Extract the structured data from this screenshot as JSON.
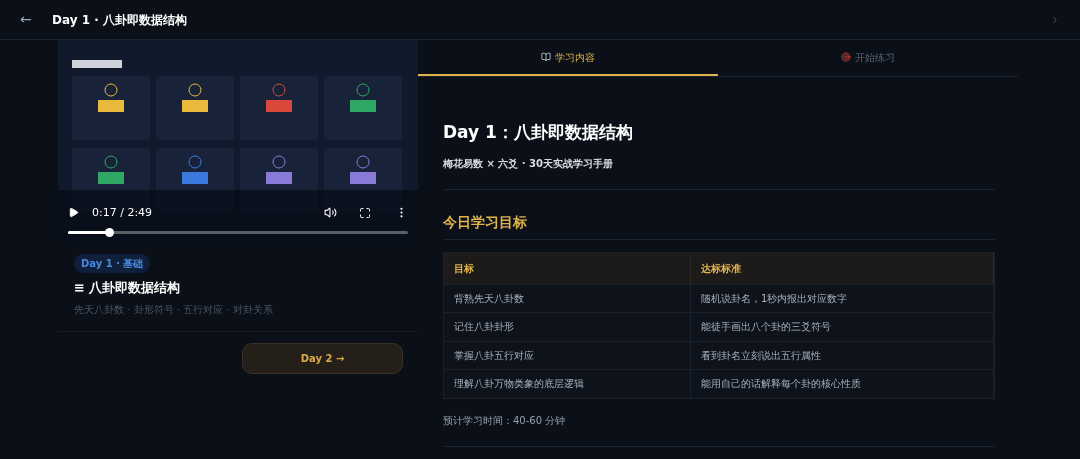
{
  "header": {
    "back": "←",
    "title": "Day 1 · 八卦即数据结构"
  },
  "video": {
    "kind": "picture",
    "time": "0:17 / 2:49",
    "level": 0.12
  },
  "lesson": {
    "badge": "Day 1 · 基础",
    "title": "≡ 八卦即数据结构",
    "topics": "先天八卦数 · 卦形符号 · 五行对应 · 对卦关系",
    "next": "Day 2 →"
  },
  "tabs": [
    {
      "label": "学习内容",
      "selected": true
    },
    {
      "label": "开始练习",
      "selected": false
    }
  ],
  "content": {
    "title": "Day 1：八卦即数据结构",
    "subtitle": "梅花易数 × 六爻 · 30天实战学习手册",
    "section": "今日学习目标",
    "table": {
      "columns": [
        "目标",
        "达标标准"
      ],
      "rows": [
        [
          "背熟先天八卦数",
          "随机说卦名，1秒内报出对应数字"
        ],
        [
          "记住八卦卦形",
          "能徒手画出八个卦的三爻符号"
        ],
        [
          "掌握八卦五行对应",
          "看到卦名立刻说出五行属性"
        ],
        [
          "理解八卦万物类象的底层逻辑",
          "能用自己的话解释每个卦的核心性质"
        ]
      ]
    },
    "time": "预计学习时间：40-60 分钟"
  }
}
